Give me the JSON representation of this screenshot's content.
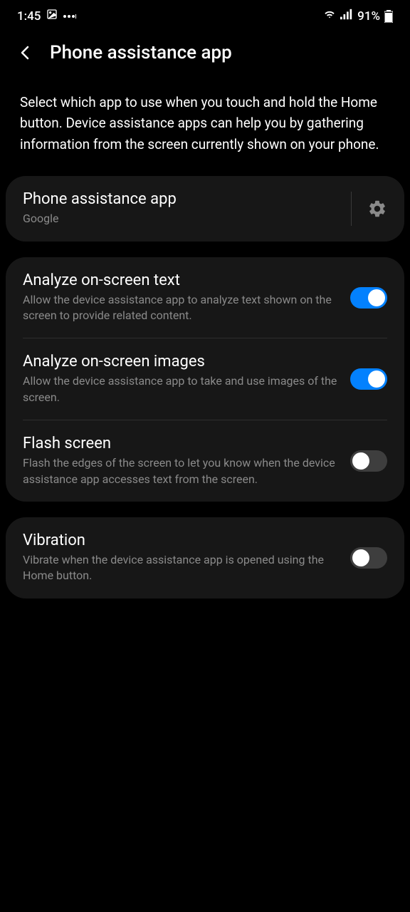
{
  "statusBar": {
    "time": "1:45",
    "battery": "91%"
  },
  "header": {
    "title": "Phone assistance app"
  },
  "description": "Select which app to use when you touch and hold the Home button. Device assistance apps can help you by gathering information from the screen currently shown on your phone.",
  "apps": {
    "title": "Phone assistance app",
    "selected": "Google"
  },
  "settings": {
    "analyzeText": {
      "title": "Analyze on-screen text",
      "description": "Allow the device assistance app to analyze text shown on the screen to provide related content.",
      "enabled": true
    },
    "analyzeImages": {
      "title": "Analyze on-screen images",
      "description": "Allow the device assistance app to take and use images of the screen.",
      "enabled": true
    },
    "flashScreen": {
      "title": "Flash screen",
      "description": "Flash the edges of the screen to let you know when the device assistance app accesses text from the screen.",
      "enabled": false
    },
    "vibration": {
      "title": "Vibration",
      "description": "Vibrate when the device assistance app is opened using the Home button.",
      "enabled": false
    }
  }
}
